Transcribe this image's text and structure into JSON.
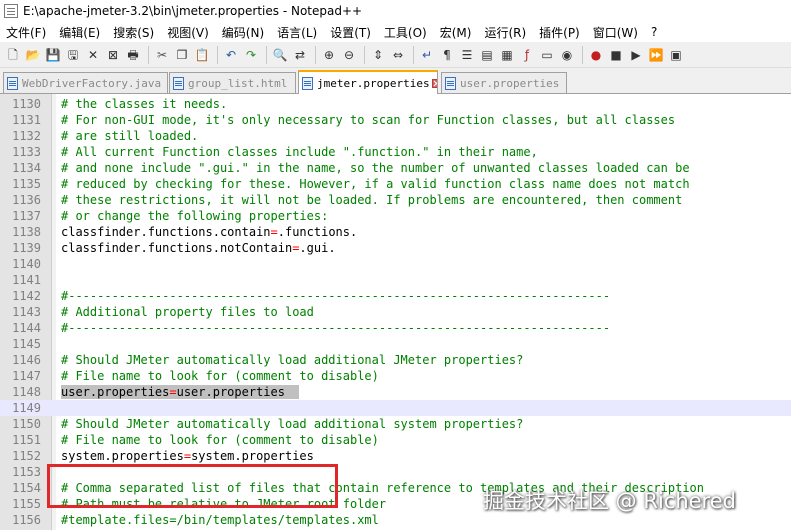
{
  "window": {
    "title": "E:\\apache-jmeter-3.2\\bin\\jmeter.properties - Notepad++"
  },
  "menu": [
    "文件(F)",
    "编辑(E)",
    "搜索(S)",
    "视图(V)",
    "编码(N)",
    "语言(L)",
    "设置(T)",
    "工具(O)",
    "宏(M)",
    "运行(R)",
    "插件(P)",
    "窗口(W)",
    "?"
  ],
  "toolbar_icons": [
    "new-file-icon",
    "open-file-icon",
    "save-icon",
    "save-all-icon",
    "close-icon",
    "close-all-icon",
    "print-icon",
    "sep",
    "cut-icon",
    "copy-icon",
    "paste-icon",
    "sep",
    "undo-icon",
    "redo-icon",
    "sep",
    "find-icon",
    "replace-icon",
    "sep",
    "zoom-in-icon",
    "zoom-out-icon",
    "sep",
    "sync-v-icon",
    "sync-h-icon",
    "sep",
    "word-wrap-icon",
    "show-all-chars-icon",
    "indent-guide-icon",
    "user-lang-icon",
    "doc-map-icon",
    "function-list-icon",
    "folder-workspace-icon",
    "monitor-icon",
    "sep",
    "record-macro-icon",
    "stop-macro-icon",
    "play-macro-icon",
    "run-macro-multiple-icon",
    "save-macro-icon"
  ],
  "tabs": [
    {
      "label": "WebDriverFactory.java",
      "active": false
    },
    {
      "label": "group_list.html",
      "active": false
    },
    {
      "label": "jmeter.properties",
      "active": true
    },
    {
      "label": "user.properties",
      "active": false
    }
  ],
  "editor": {
    "lines": [
      {
        "num": "1130",
        "type": "comment",
        "text": "# the classes it needs."
      },
      {
        "num": "1131",
        "type": "comment",
        "text": "# For non-GUI mode, it's only necessary to scan for Function classes, but all classes"
      },
      {
        "num": "1132",
        "type": "comment",
        "text": "# are still loaded."
      },
      {
        "num": "1133",
        "type": "comment",
        "text": "# All current Function classes include \".function.\" in their name,"
      },
      {
        "num": "1134",
        "type": "comment",
        "text": "# and none include \".gui.\" in the name, so the number of unwanted classes loaded can be"
      },
      {
        "num": "1135",
        "type": "comment",
        "text": "# reduced by checking for these. However, if a valid function class name does not match"
      },
      {
        "num": "1136",
        "type": "comment",
        "text": "# these restrictions, it will not be loaded. If problems are encountered, then comment"
      },
      {
        "num": "1137",
        "type": "comment",
        "text": "# or change the following properties:"
      },
      {
        "num": "1138",
        "type": "prop",
        "key": "classfinder.functions.contain",
        "value": ".functions."
      },
      {
        "num": "1139",
        "type": "prop",
        "key": "classfinder.functions.notContain",
        "value": ".gui."
      },
      {
        "num": "1140",
        "type": "blank",
        "text": ""
      },
      {
        "num": "1141",
        "type": "blank",
        "text": ""
      },
      {
        "num": "1142",
        "type": "comment",
        "text": "#---------------------------------------------------------------------------"
      },
      {
        "num": "1143",
        "type": "comment",
        "text": "# Additional property files to load"
      },
      {
        "num": "1144",
        "type": "comment",
        "text": "#---------------------------------------------------------------------------"
      },
      {
        "num": "1145",
        "type": "blank",
        "text": ""
      },
      {
        "num": "1146",
        "type": "comment",
        "text": "# Should JMeter automatically load additional JMeter properties?"
      },
      {
        "num": "1147",
        "type": "comment",
        "text": "# File name to look for (comment to disable)"
      },
      {
        "num": "1148",
        "type": "prop",
        "key": "user.properties",
        "value": "user.properties",
        "selected": true
      },
      {
        "num": "1149",
        "type": "blank",
        "text": "",
        "current": true
      },
      {
        "num": "1150",
        "type": "comment",
        "text": "# Should JMeter automatically load additional system properties?"
      },
      {
        "num": "1151",
        "type": "comment",
        "text": "# File name to look for (comment to disable)"
      },
      {
        "num": "1152",
        "type": "prop",
        "key": "system.properties",
        "value": "system.properties"
      },
      {
        "num": "1153",
        "type": "blank",
        "text": ""
      },
      {
        "num": "1154",
        "type": "comment",
        "text": "# Comma separated list of files that contain reference to templates and their description"
      },
      {
        "num": "1155",
        "type": "comment",
        "text": "# Path must be relative to JMeter root folder"
      },
      {
        "num": "1156",
        "type": "comment",
        "text": "#template.files=/bin/templates/templates.xml"
      }
    ]
  },
  "watermark": "掘金技术社区 @ Richered",
  "colors": {
    "comment": "#008000",
    "operator": "#ff0000",
    "highlight_box": "#e0272a",
    "active_tab_accent": "#f9ab00"
  }
}
